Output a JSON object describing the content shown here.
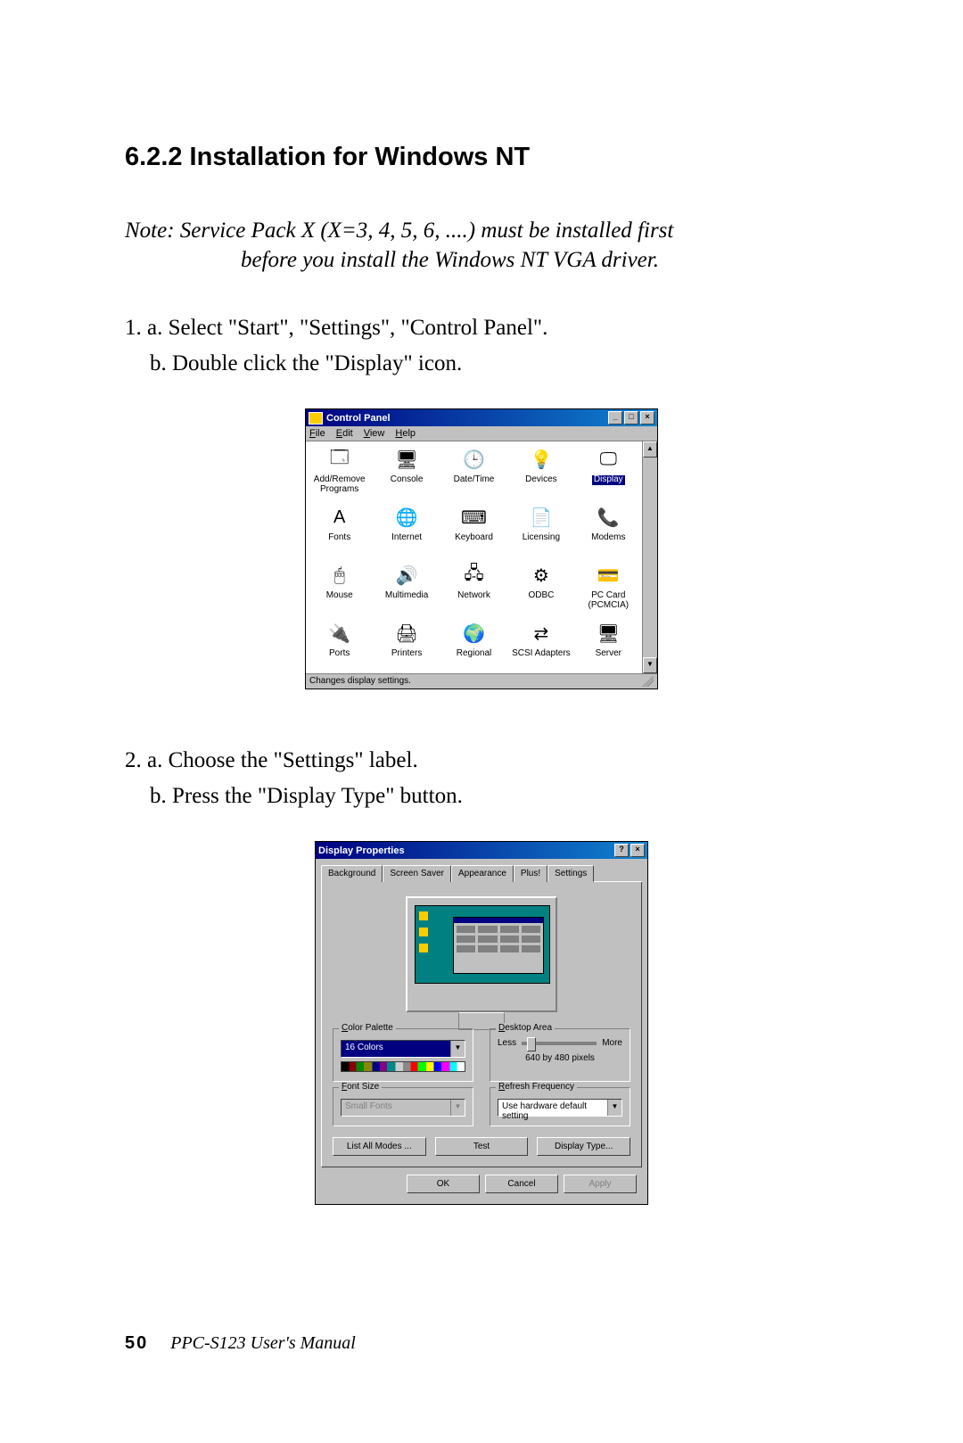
{
  "heading": "6.2.2 Installation for Windows NT",
  "note": {
    "line1": "Note: Service Pack X (X=3, 4, 5,  6, ....) must be installed first",
    "line2": "before you install the Windows NT VGA driver."
  },
  "step1": {
    "a": "1. a. Select \"Start\", \"Settings\", \"Control Panel\".",
    "b": "b. Double click the \"Display\" icon."
  },
  "step2": {
    "a": "2. a. Choose the \"Settings\" label.",
    "b": "b. Press the \"Display Type\" button."
  },
  "control_panel": {
    "title": "Control Panel",
    "menu": {
      "file": "File",
      "edit": "Edit",
      "view": "View",
      "help": "Help"
    },
    "items": [
      {
        "label": "Add/Remove Programs",
        "icon": "🗔",
        "selected": false
      },
      {
        "label": "Console",
        "icon": "🖥",
        "selected": false
      },
      {
        "label": "Date/Time",
        "icon": "🕒",
        "selected": false
      },
      {
        "label": "Devices",
        "icon": "💡",
        "selected": false
      },
      {
        "label": "Display",
        "icon": "🖵",
        "selected": true
      },
      {
        "label": "Fonts",
        "icon": "A",
        "selected": false
      },
      {
        "label": "Internet",
        "icon": "🌐",
        "selected": false
      },
      {
        "label": "Keyboard",
        "icon": "⌨",
        "selected": false
      },
      {
        "label": "Licensing",
        "icon": "📄",
        "selected": false
      },
      {
        "label": "Modems",
        "icon": "📞",
        "selected": false
      },
      {
        "label": "Mouse",
        "icon": "🖱",
        "selected": false
      },
      {
        "label": "Multimedia",
        "icon": "🔊",
        "selected": false
      },
      {
        "label": "Network",
        "icon": "🖧",
        "selected": false
      },
      {
        "label": "ODBC",
        "icon": "⚙",
        "selected": false
      },
      {
        "label": "PC Card (PCMCIA)",
        "icon": "💳",
        "selected": false
      },
      {
        "label": "Ports",
        "icon": "🔌",
        "selected": false
      },
      {
        "label": "Printers",
        "icon": "🖨",
        "selected": false
      },
      {
        "label": "Regional",
        "icon": "🌍",
        "selected": false
      },
      {
        "label": "SCSI Adapters",
        "icon": "⇄",
        "selected": false
      },
      {
        "label": "Server",
        "icon": "🖥",
        "selected": false
      }
    ],
    "status": "Changes display settings."
  },
  "display_props": {
    "title": "Display Properties",
    "tabs": {
      "background": "Background",
      "screensaver": "Screen Saver",
      "appearance": "Appearance",
      "plus": "Plus!",
      "settings": "Settings"
    },
    "groups": {
      "color_palette": "Color Palette",
      "desktop_area": "Desktop Area",
      "font_size": "Font Size",
      "refresh_frequency": "Refresh Frequency"
    },
    "values": {
      "color_palette": "16 Colors",
      "less": "Less",
      "more": "More",
      "resolution": "640 by 480 pixels",
      "font_size": "Small Fonts",
      "refresh": "Use hardware default setting"
    },
    "buttons": {
      "list_modes": "List All Modes ...",
      "test": "Test",
      "display_type": "Display Type...",
      "ok": "OK",
      "cancel": "Cancel",
      "apply": "Apply"
    }
  },
  "footer": {
    "page": "50",
    "book": "PPC-S123  User's Manual"
  }
}
